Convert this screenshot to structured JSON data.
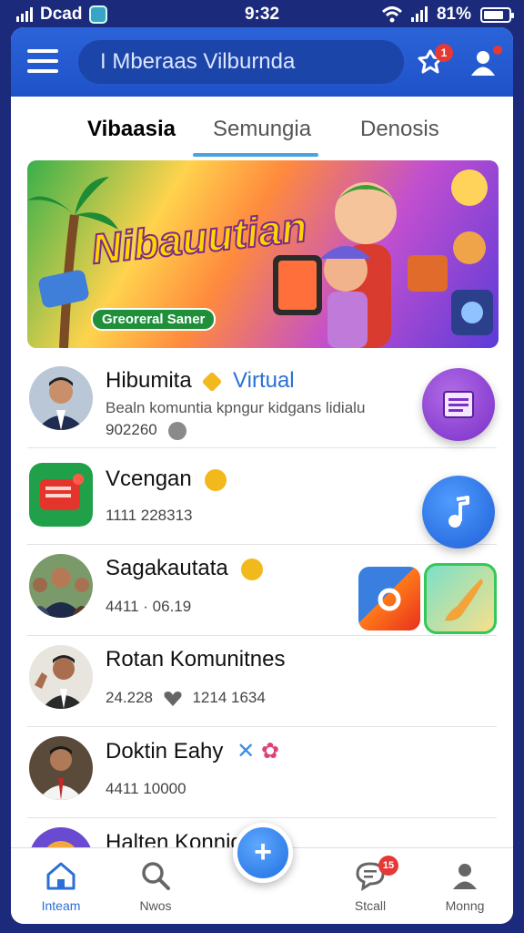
{
  "status_bar": {
    "carrier": "Dcad",
    "time": "9:32",
    "battery": "81%",
    "battery_level": 0.81
  },
  "header": {
    "search_text": "I Mberaas Vilburnda",
    "notification_count": "1"
  },
  "tabs": [
    {
      "label": "Vibaasia",
      "active": true
    },
    {
      "label": "Semungia",
      "active": false
    },
    {
      "label": "Denosis",
      "active": false
    }
  ],
  "banner": {
    "title": "Nibauutian",
    "subtitle": "Greoreral Saner"
  },
  "list": [
    {
      "title": "Hibumita",
      "tag": "Virtual",
      "subtitle": "Bealn komuntia kpngur kidgans lidialu",
      "meta": "902260"
    },
    {
      "title": "Vcengan",
      "meta": "1111 228313"
    },
    {
      "title": "Sagakautata",
      "meta": "4411 · 06.19"
    },
    {
      "title": "Rotan Komunitnes",
      "meta": "24.228",
      "meta2": "1214 1634"
    },
    {
      "title": "Doktin Eahy",
      "meta": "4411 10000"
    },
    {
      "title": "Halten Konnig"
    }
  ],
  "bottom_nav": [
    {
      "label": "Inteam",
      "icon": "home-icon",
      "active": true
    },
    {
      "label": "Nwos",
      "icon": "search-icon",
      "active": false
    },
    {
      "label": "",
      "icon": "plus-icon",
      "active": false
    },
    {
      "label": "Stcall",
      "icon": "chat-icon",
      "active": false,
      "badge": "15"
    },
    {
      "label": "Monng",
      "icon": "profile-icon",
      "active": false
    }
  ],
  "colors": {
    "header_bg": "#2b63d9",
    "accent": "#2a6fd6",
    "badge": "#e53935"
  }
}
